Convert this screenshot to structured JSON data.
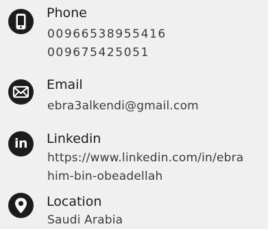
{
  "contacts": {
    "phone": {
      "icon": "phone-icon",
      "label": "Phone",
      "values": [
        "00966538955416",
        "009675425051"
      ]
    },
    "email": {
      "icon": "envelope-icon",
      "label": "Email",
      "value": "ebra3alkendi@gmail.com"
    },
    "linkedin": {
      "icon": "linkedin-icon",
      "icon_text": "in",
      "label": "Linkedin",
      "value_line1": "https://www.linkedin.com/in/ebra",
      "value_line2": "him-bin-obeadellah"
    },
    "location": {
      "icon": "map-pin-icon",
      "label": "Location",
      "value": "Saudi Arabia"
    }
  },
  "colors": {
    "background": "#f0f0f0",
    "icon_bg": "#1c1c1c",
    "text": "#1a1a1a",
    "muted_text": "#3a3a3a"
  }
}
